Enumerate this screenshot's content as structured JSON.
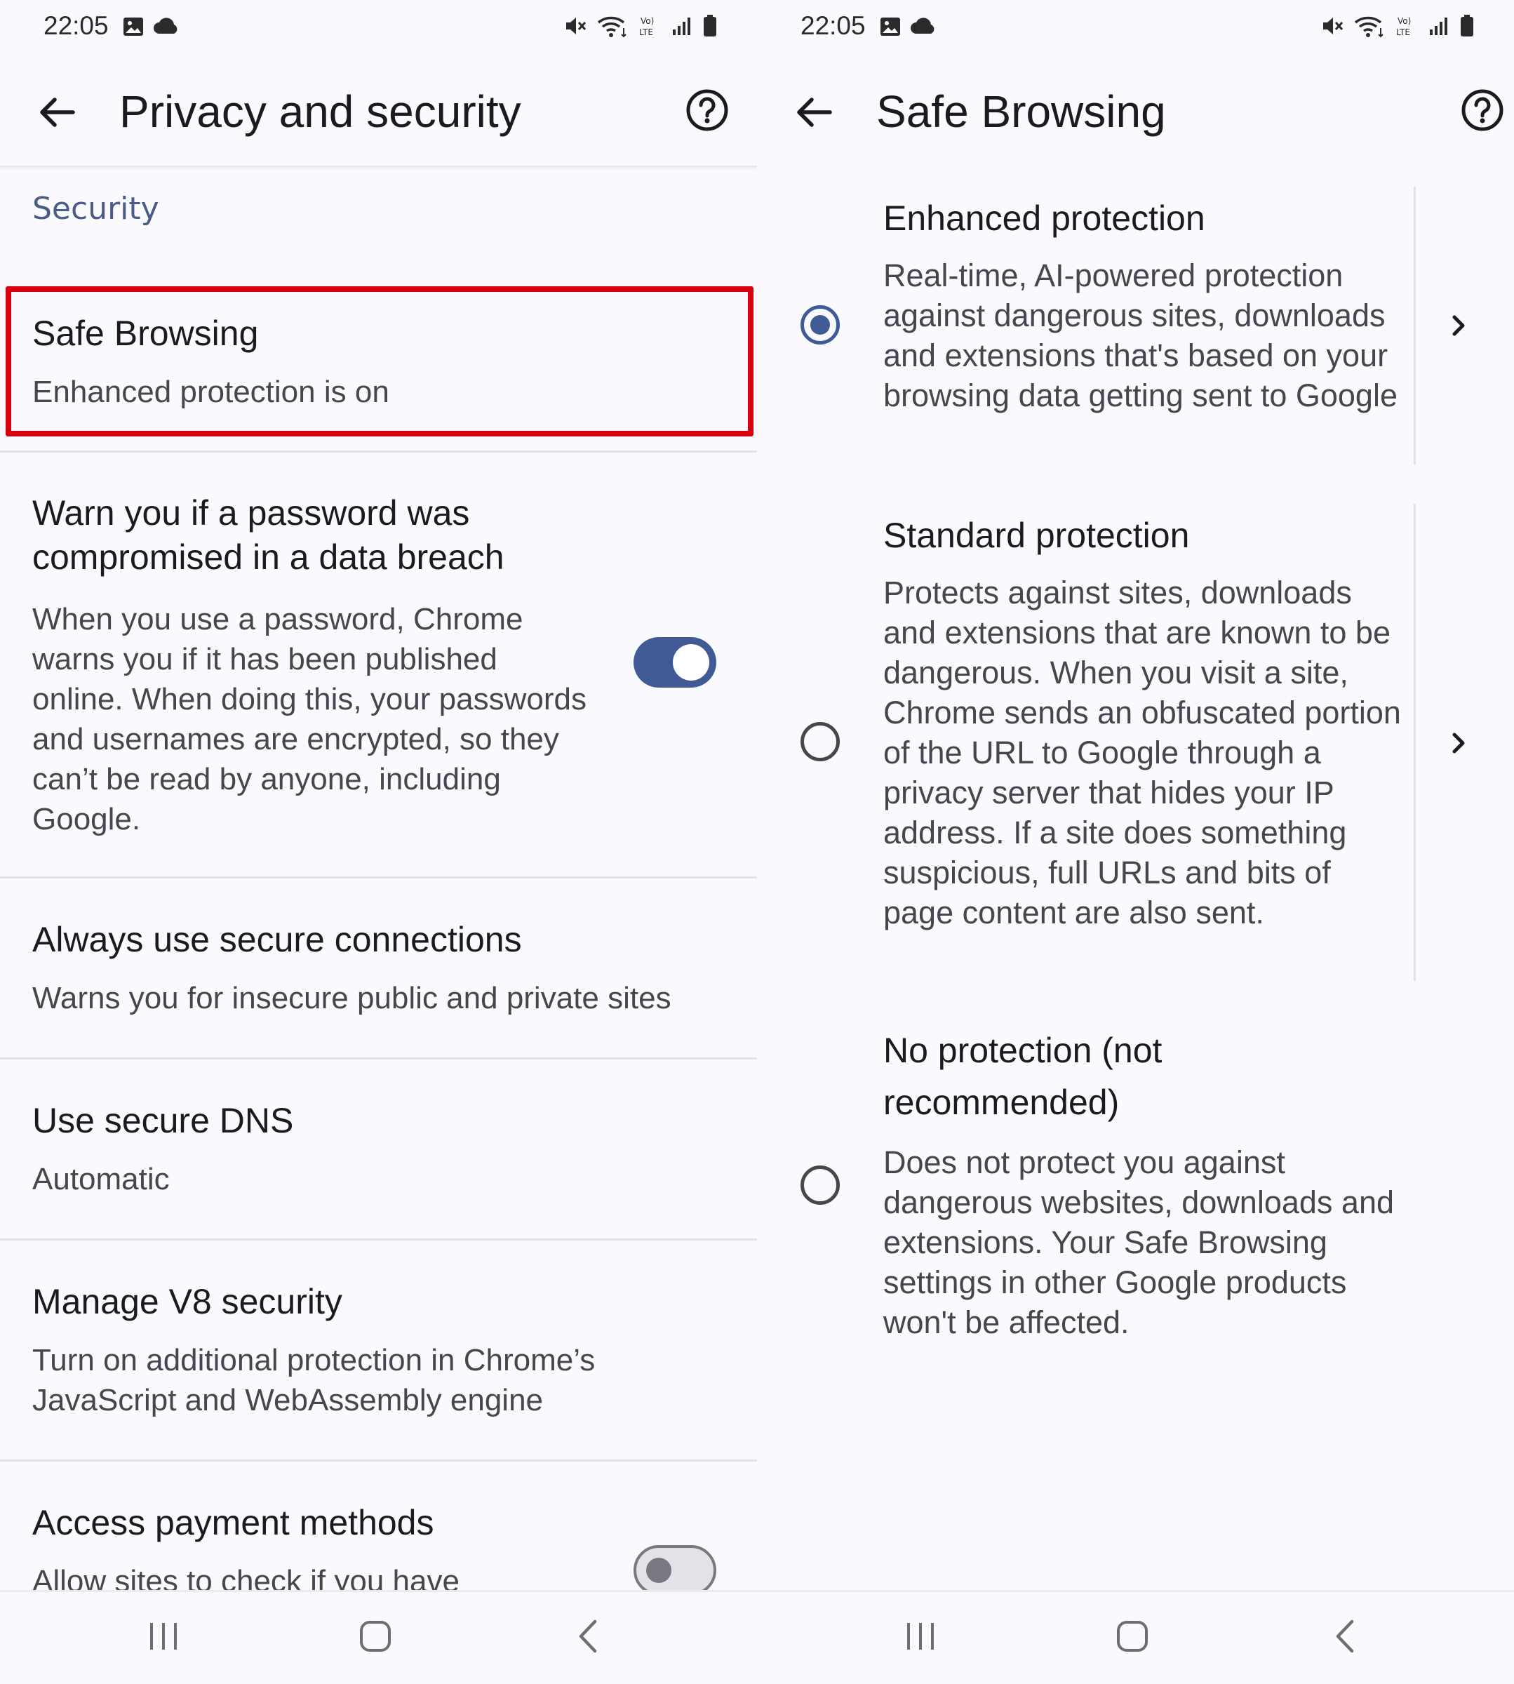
{
  "colors": {
    "accent": "#405a96",
    "highlight_border": "#d9000d",
    "background": "#faf9fd",
    "section_header": "#4a5b86"
  },
  "left": {
    "status": {
      "time": "22:05"
    },
    "appbar": {
      "title": "Privacy and security"
    },
    "section_header": "Security",
    "items": [
      {
        "title": "Safe Browsing",
        "summary": "Enhanced protection is on"
      },
      {
        "title": "Warn you if a password was compromised in a data breach",
        "summary": "When you use a password, Chrome warns you if it has been published online. When doing this, your passwords and usernames are encrypted, so they can’t be read by anyone, including Google.",
        "toggle": "on"
      },
      {
        "title": "Always use secure connections",
        "summary": "Warns you for insecure public and private sites"
      },
      {
        "title": "Use secure DNS",
        "summary": "Automatic"
      },
      {
        "title": "Manage V8 security",
        "summary": "Turn on additional protection in Chrome’s JavaScript and WebAssembly engine"
      },
      {
        "title": "Access payment methods",
        "summary": "Allow sites to check if you have",
        "toggle": "off"
      }
    ]
  },
  "right": {
    "status": {
      "time": "22:05"
    },
    "appbar": {
      "title": "Safe Browsing"
    },
    "options": [
      {
        "title": "Enhanced protection",
        "description": "Real-time, AI-powered protection against dangerous sites, downloads and extensions that's based on your browsing data getting sent to Google",
        "selected": true
      },
      {
        "title": "Standard protection",
        "description": "Protects against sites, downloads and extensions that are known to be dangerous. When you visit a site, Chrome sends an obfuscated portion of the URL to Google through a privacy server that hides your IP address. If a site does something suspicious, full URLs and bits of page content are also sent.",
        "selected": false
      },
      {
        "title": "No protection (not recommended)",
        "description": "Does not protect you against dangerous websites, downloads and extensions. Your Safe Browsing settings in other Google products won't be affected.",
        "selected": false
      }
    ]
  },
  "icons": {
    "status_left": [
      "gallery-icon",
      "cloud-icon"
    ],
    "status_right": [
      "mute-icon",
      "wifi-icon",
      "volte-icon",
      "signal-icon",
      "battery-icon"
    ],
    "appbar": [
      "back-arrow-icon",
      "help-icon"
    ],
    "options": [
      "chevron-right-icon"
    ],
    "navbar": [
      "recents-icon",
      "home-icon",
      "back-icon"
    ]
  }
}
